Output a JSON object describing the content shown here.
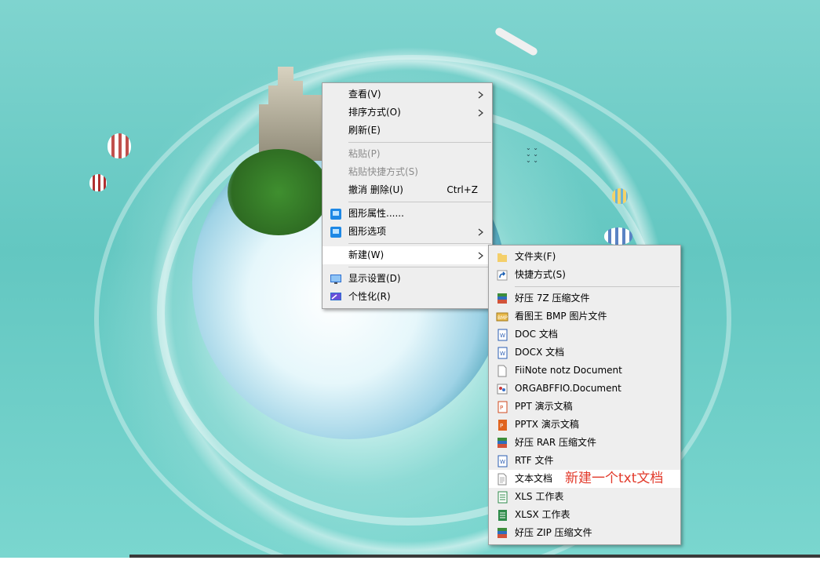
{
  "context_menu": {
    "items": [
      {
        "label": "查看(V)",
        "submenu": true
      },
      {
        "label": "排序方式(O)",
        "submenu": true
      },
      {
        "label": "刷新(E)"
      },
      {
        "label": "粘贴(P)",
        "disabled": true
      },
      {
        "label": "粘贴快捷方式(S)",
        "disabled": true
      },
      {
        "label": "撤消 删除(U)",
        "shortcut": "Ctrl+Z"
      },
      {
        "label": "图形属性......",
        "icon": "graphics-properties-icon"
      },
      {
        "label": "图形选项",
        "icon": "graphics-options-icon",
        "submenu": true
      },
      {
        "label": "新建(W)",
        "submenu": true,
        "highlighted": true
      },
      {
        "label": "显示设置(D)",
        "icon": "display-settings-icon"
      },
      {
        "label": "个性化(R)",
        "icon": "personalize-icon"
      }
    ]
  },
  "new_submenu": {
    "items": [
      {
        "label": "文件夹(F)",
        "icon": "folder-icon"
      },
      {
        "label": "快捷方式(S)",
        "icon": "shortcut-icon"
      },
      {
        "label": "好压 7Z 压缩文件",
        "icon": "haozip-archive-icon"
      },
      {
        "label": "看图王 BMP 图片文件",
        "icon": "bmp-image-icon"
      },
      {
        "label": "DOC 文档",
        "icon": "word-doc-icon"
      },
      {
        "label": "DOCX 文档",
        "icon": "word-doc-icon"
      },
      {
        "label": "FiiNote notz Document",
        "icon": "blank-file-icon"
      },
      {
        "label": "ORGABFFIO.Document",
        "icon": "orgabffio-icon"
      },
      {
        "label": "PPT 演示文稿",
        "icon": "ppt-icon"
      },
      {
        "label": "PPTX 演示文稿",
        "icon": "ppt-icon"
      },
      {
        "label": "好压 RAR 压缩文件",
        "icon": "haozip-archive-icon"
      },
      {
        "label": "RTF 文件",
        "icon": "word-doc-icon"
      },
      {
        "label": "文本文档",
        "icon": "text-file-icon",
        "highlighted": true
      },
      {
        "label": "XLS 工作表",
        "icon": "excel-icon"
      },
      {
        "label": "XLSX 工作表",
        "icon": "excel-icon"
      },
      {
        "label": "好压 ZIP 压缩文件",
        "icon": "haozip-archive-icon"
      }
    ]
  },
  "annotation": "新建一个txt文档",
  "colors": {
    "menu_bg": "#eeeeee",
    "highlight": "#ffffff",
    "annotation": "#e23a2b",
    "desktop": "#6ccbc5"
  }
}
